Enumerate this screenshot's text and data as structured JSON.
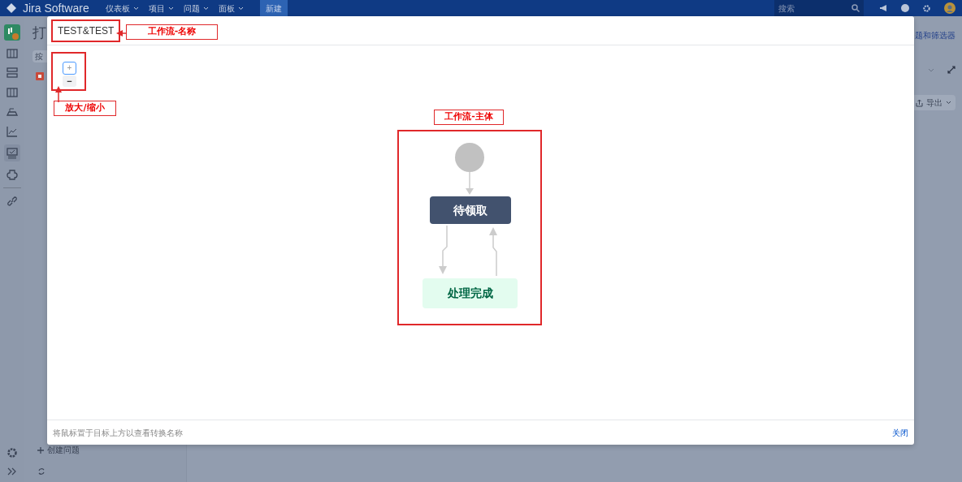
{
  "navbar": {
    "logo": "Jira Software",
    "menus": [
      {
        "label": "仪表板"
      },
      {
        "label": "项目"
      },
      {
        "label": "问题"
      },
      {
        "label": "面板"
      }
    ],
    "create_button": "新建",
    "search": {
      "placeholder": "搜索"
    }
  },
  "background": {
    "page_title": "打",
    "filter_button": "按",
    "filters_link": "题和筛选器",
    "export_button": "导出",
    "create_issue": "创建问题"
  },
  "dialog": {
    "title": "TEST&TEST",
    "zoom_in": "+",
    "zoom_out": "−",
    "statuses": [
      {
        "label": "待领取",
        "kind": "todo"
      },
      {
        "label": "处理完成",
        "kind": "done"
      }
    ],
    "hint": "将鼠标置于目标上方以查看转换名称",
    "close": "关闭"
  },
  "annotations": [
    {
      "label": "工作流-名称",
      "kind": "name"
    },
    {
      "label": "放大/缩小",
      "kind": "zoom"
    },
    {
      "label": "工作流-主体",
      "kind": "body"
    }
  ]
}
